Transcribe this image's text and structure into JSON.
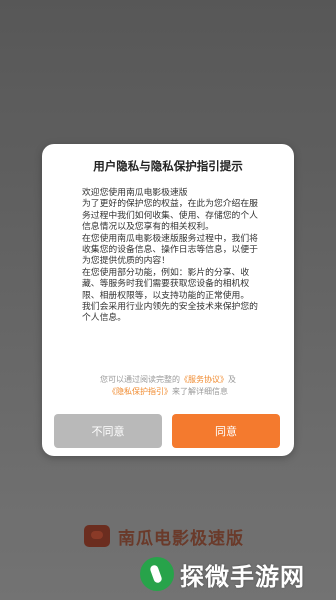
{
  "dialog": {
    "title": "用户隐私与隐私保护指引提示",
    "paragraphs": [
      "欢迎您使用南瓜电影极速版",
      "为了更好的保护您的权益，在此为您介绍在服务过程中我们如何收集、使用、存储您的个人信息情况以及您享有的相关权利。",
      "在您使用南瓜电影极速版服务过程中，我们将收集您的设备信息、操作日志等信息，以便于为您提供优质的内容！",
      "在您使用部分功能，例如：影片的分享、收藏、等服务时我们需要获取您设备的相机权限、相册权限等，以支持功能的正常使用。",
      "我们会采用行业内领先的安全技术来保护您的个人信息。"
    ],
    "consent": {
      "prefix": "您可以通过阅读完整的",
      "service_link": "《服务协议》",
      "and": "及",
      "privacy_link": "《隐私保护指引》",
      "suffix": "来了解详细信息"
    },
    "buttons": {
      "decline": "不同意",
      "agree": "同意"
    }
  },
  "app": {
    "name": "南瓜电影极速版"
  },
  "watermark": {
    "text": "探微手游网"
  },
  "colors": {
    "accent": "#f47a2e",
    "link": "#f08a2e",
    "decline_bg": "#b9b9b9"
  }
}
